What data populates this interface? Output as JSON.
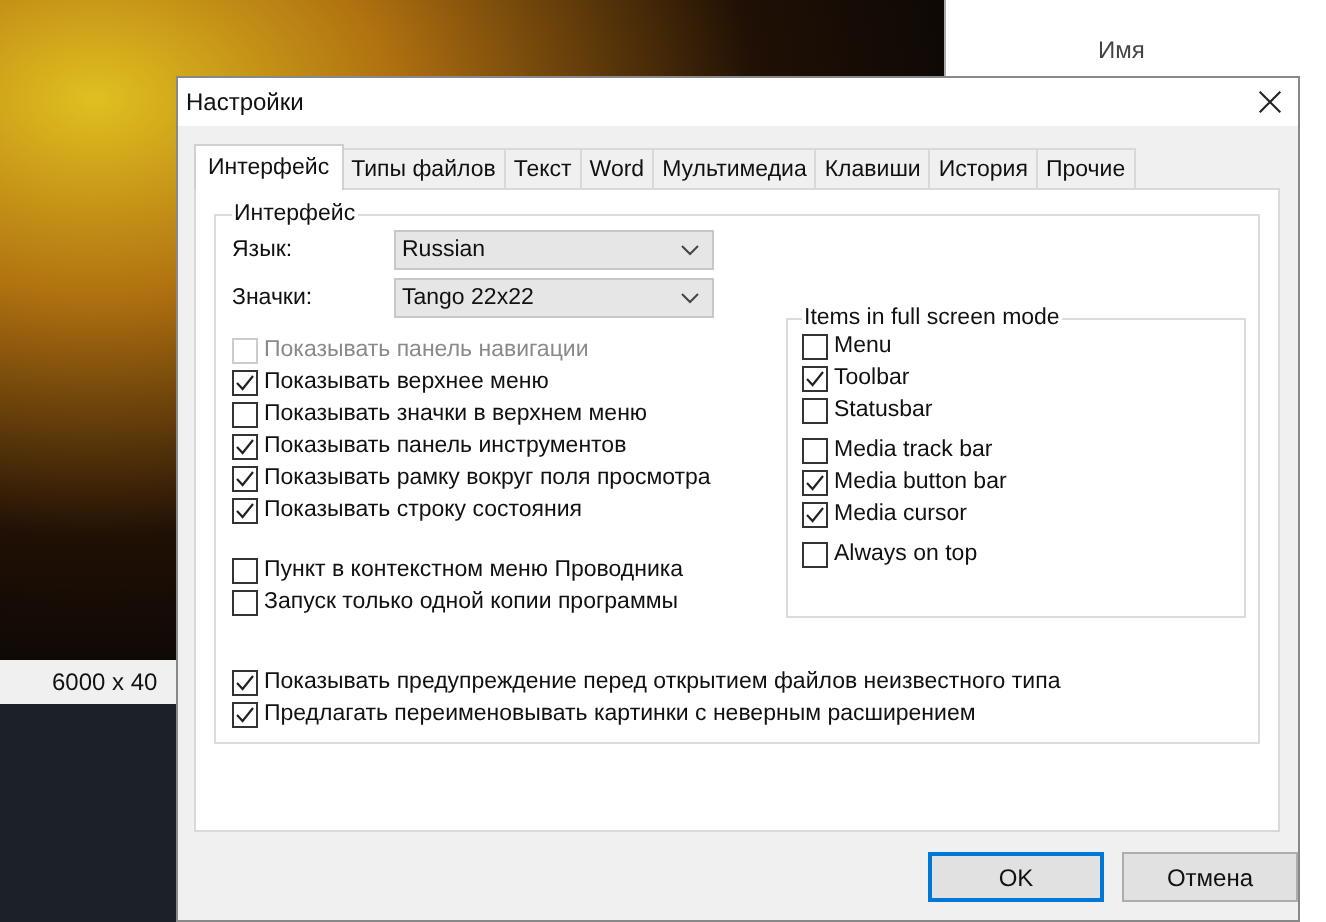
{
  "desktop": {
    "caption": "6000 x 40",
    "explorer_column": "Имя"
  },
  "dialog": {
    "title": "Настройки",
    "tabs": [
      {
        "label": "Интерфейс",
        "selected": true
      },
      {
        "label": "Типы файлов",
        "selected": false
      },
      {
        "label": "Текст",
        "selected": false
      },
      {
        "label": "Word",
        "selected": false
      },
      {
        "label": "Мультимедиа",
        "selected": false
      },
      {
        "label": "Клавиши",
        "selected": false
      },
      {
        "label": "История",
        "selected": false
      },
      {
        "label": "Прочие",
        "selected": false
      }
    ],
    "group_title": "Интерфейс",
    "fields": [
      {
        "label": "Язык:",
        "value": "Russian"
      },
      {
        "label": "Значки:",
        "value": "Tango 22x22"
      }
    ],
    "option_sections": [
      [
        {
          "label": "Показывать панель навигации",
          "checked": false,
          "disabled": true
        },
        {
          "label": "Показывать верхнее меню",
          "checked": true,
          "disabled": false
        },
        {
          "label": "Показывать значки в верхнем меню",
          "checked": false,
          "disabled": false
        },
        {
          "label": "Показывать панель инструментов",
          "checked": true,
          "disabled": false
        },
        {
          "label": "Показывать рамку вокруг поля просмотра",
          "checked": true,
          "disabled": false
        },
        {
          "label": "Показывать строку состояния",
          "checked": true,
          "disabled": false
        }
      ],
      [
        {
          "label": "Пункт в контекстном меню Проводника",
          "checked": false,
          "disabled": false
        },
        {
          "label": "Запуск только одной копии программы",
          "checked": false,
          "disabled": false
        }
      ]
    ],
    "fullscreen": {
      "title": "Items in full screen mode",
      "sections": [
        [
          {
            "label": "Menu",
            "checked": false
          },
          {
            "label": "Toolbar",
            "checked": true
          },
          {
            "label": "Statusbar",
            "checked": false
          }
        ],
        [
          {
            "label": "Media track bar",
            "checked": false
          },
          {
            "label": "Media button bar",
            "checked": true
          },
          {
            "label": "Media cursor",
            "checked": true
          }
        ],
        [
          {
            "label": "Always on top",
            "checked": false
          }
        ]
      ]
    },
    "bottom_options": [
      {
        "label": "Показывать предупреждение перед открытием файлов неизвестного типа",
        "checked": true,
        "disabled": false
      },
      {
        "label": "Предлагать переименовывать картинки с неверным расширением",
        "checked": true,
        "disabled": false
      }
    ],
    "buttons": [
      {
        "label": "OK",
        "default": true
      },
      {
        "label": "Отмена",
        "default": false
      }
    ]
  }
}
